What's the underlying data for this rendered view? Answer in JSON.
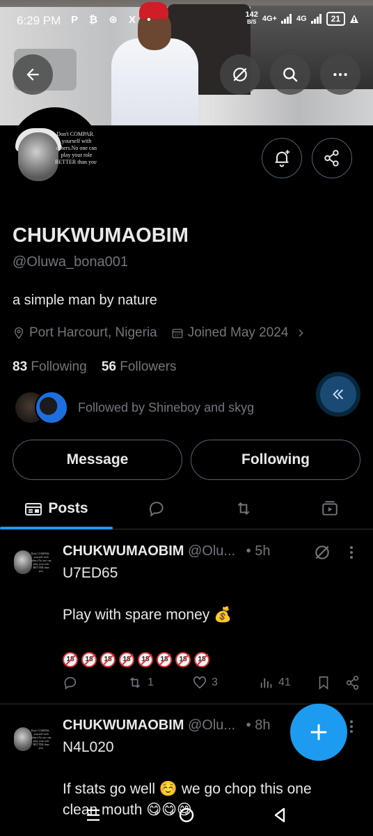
{
  "status_bar": {
    "time": "6:29 PM",
    "notification_icons": "P ₿ ⊛ X •",
    "speed_value": "142",
    "speed_unit": "B/S",
    "network_1": "4G+",
    "network_2": "4G",
    "battery": "21"
  },
  "avatar_quote": "Don't COMPARE yourself with others.No one can play your role BETTER than you.",
  "profile": {
    "display_name": "CHUKWUMAOBIM",
    "handle": "@Oluwa_bona001",
    "bio": "a simple man by nature",
    "location": "Port Harcourt, Nigeria",
    "joined": "Joined May 2024",
    "following_count": "83",
    "following_label": "Following",
    "followers_count": "56",
    "followers_label": "Followers",
    "followed_by": "Followed by Shineboy and skyg"
  },
  "buttons": {
    "message": "Message",
    "following": "Following"
  },
  "tabs": {
    "posts": "Posts"
  },
  "posts": [
    {
      "name": "CHUKWUMAOBIM",
      "handle": "@Olu...",
      "time": "• 5h",
      "line1": "U7ED65",
      "line2": "Play with spare money 💰",
      "age_badge": "18",
      "reply_count": "",
      "repost_count": "1",
      "like_count": "3",
      "view_count": "41"
    },
    {
      "name": "CHUKWUMAOBIM",
      "handle": "@Olu...",
      "time": "• 8h",
      "line1": "N4L020",
      "line2": "If stats go well ☺️ we go chop this one",
      "line3": "clean mouth 😋😋😋"
    }
  ],
  "colors": {
    "accent": "#1d9bf0",
    "background": "#000000",
    "muted_text": "#71767b"
  }
}
